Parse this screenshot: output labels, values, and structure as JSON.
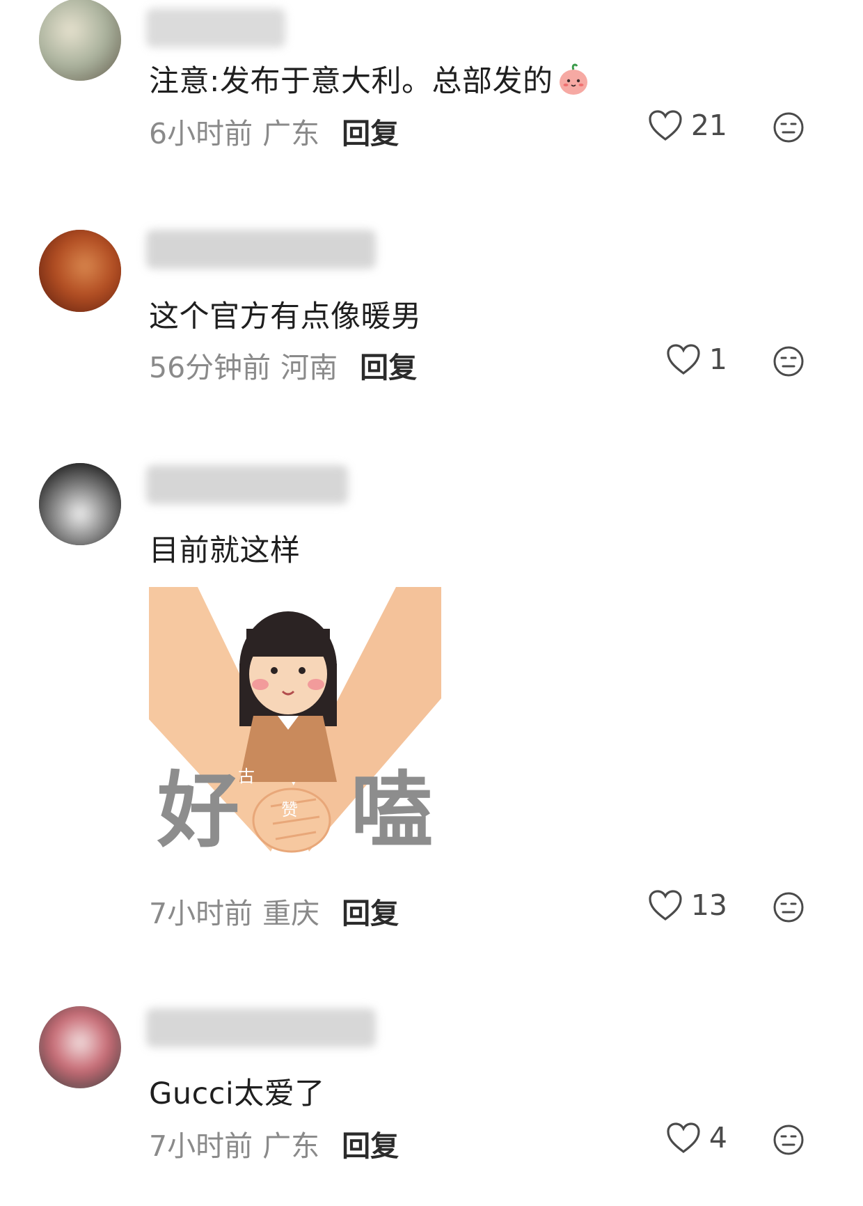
{
  "comments": [
    {
      "text": "注意:发布于意大利。总部发的",
      "time": "6小时前",
      "location": "广东",
      "reply_label": "回复",
      "likes": "21",
      "emoji": "peach-face-emoji"
    },
    {
      "text": "这个官方有点像暖男",
      "time": "56分钟前",
      "location": "河南",
      "reply_label": "回复",
      "likes": "1"
    },
    {
      "text": "目前就这样",
      "time": "7小时前",
      "location": "重庆",
      "reply_label": "回复",
      "likes": "13",
      "sticker": {
        "left_char": "好",
        "right_char": "嗑",
        "small_1": "古",
        "small_2": "赞"
      }
    },
    {
      "text": "Gucci太爱了",
      "time": "7小时前",
      "location": "广东",
      "reply_label": "回复",
      "likes": "4"
    }
  ],
  "icons": {
    "like": "heart-outline-icon",
    "dislike": "neutral-face-icon"
  },
  "colors": {
    "text": "#1f1f1f",
    "meta": "#8a8a8a",
    "icon": "#4a4a4a"
  }
}
